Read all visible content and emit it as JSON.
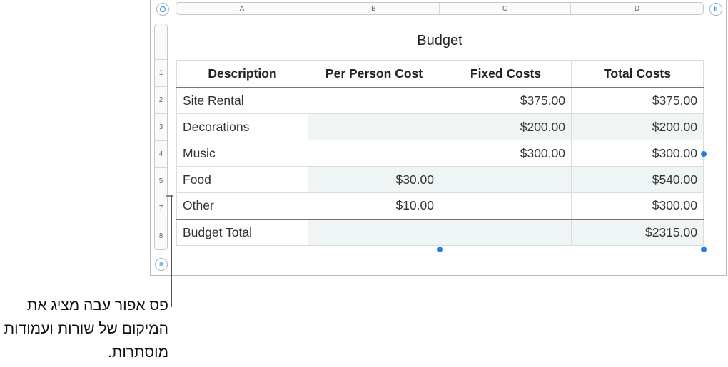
{
  "columns": [
    "A",
    "B",
    "C",
    "D"
  ],
  "row_headers": [
    "1",
    "2",
    "3",
    "4",
    "5",
    "7",
    "8"
  ],
  "controls": {
    "table_select_icon": "circle-ring-icon",
    "freeze_icon": "pause-bars-icon",
    "freeze_symbol": "II",
    "add_rows_icon": "equals-icon",
    "add_rows_symbol": "="
  },
  "table": {
    "title": "Budget",
    "headers": [
      "Description",
      "Per Person Cost",
      "Fixed Costs",
      "Total Costs"
    ],
    "rows": [
      [
        "Site Rental",
        "",
        "$375.00",
        "$375.00"
      ],
      [
        "Decorations",
        "",
        "$200.00",
        "$200.00"
      ],
      [
        "Music",
        "",
        "$300.00",
        "$300.00"
      ],
      [
        "Food",
        "$30.00",
        "",
        "$540.00"
      ],
      [
        "Other",
        "$10.00",
        "",
        "$300.00"
      ]
    ],
    "footer": [
      "Budget Total",
      "",
      "",
      "$2315.00"
    ]
  },
  "callout": {
    "text": "פס אפור עבה מציג את המיקום של שורות ועמודות מוסתרות."
  },
  "colors": {
    "accent": "#1d7fe0",
    "alt_row": "#eef5f4",
    "hidden_marker": "#8a8a8a"
  }
}
